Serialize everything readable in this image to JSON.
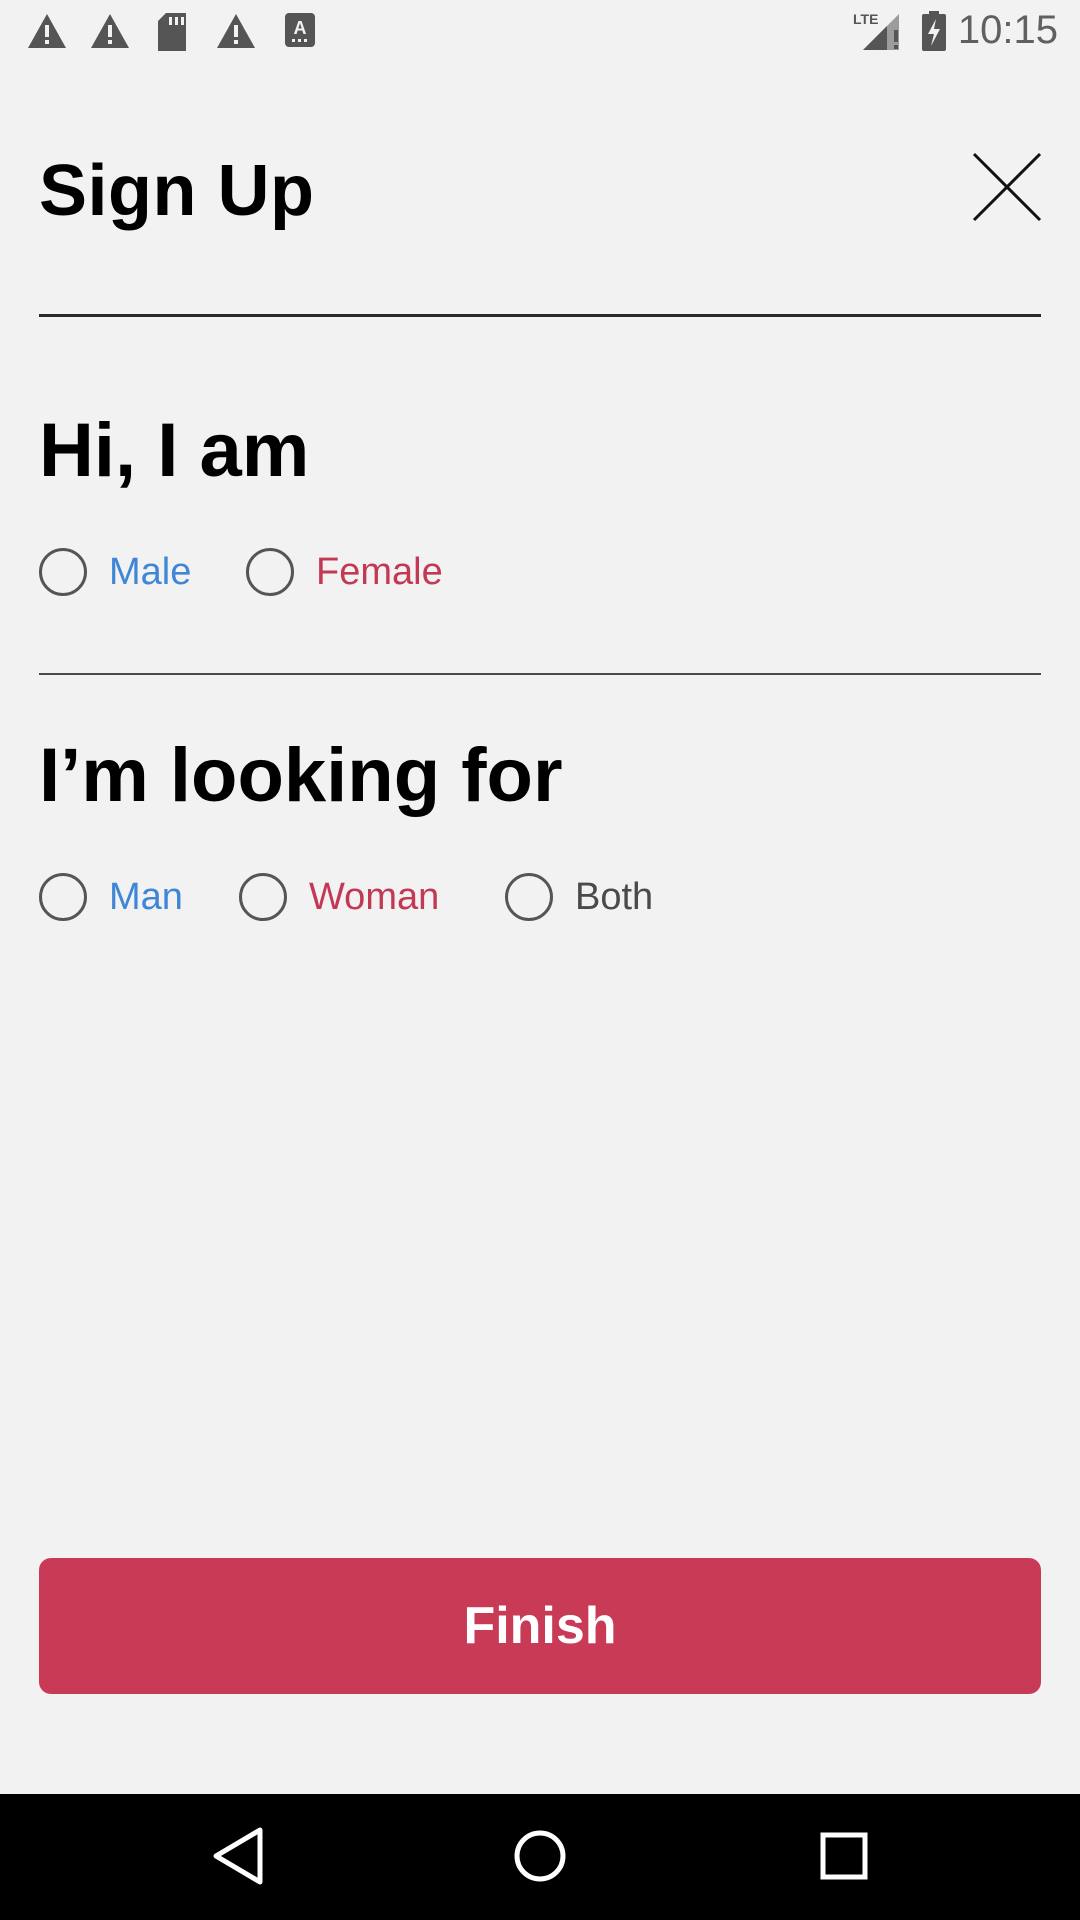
{
  "status_bar": {
    "icons_left": [
      "warning-icon",
      "warning-icon",
      "sd-card-icon",
      "warning-icon",
      "text-notification-icon"
    ],
    "network": "LTE",
    "time": "10:15"
  },
  "header": {
    "title": "Sign Up",
    "close_icon": "close-icon"
  },
  "gender_section": {
    "title": "Hi, I am",
    "options": [
      {
        "label": "Male",
        "color": "#3f87d6",
        "selected": false
      },
      {
        "label": "Female",
        "color": "#c33953",
        "selected": false
      }
    ]
  },
  "looking_for_section": {
    "title": "I’m looking for",
    "options": [
      {
        "label": "Man",
        "color": "#3f87d6",
        "selected": false
      },
      {
        "label": "Woman",
        "color": "#c33953",
        "selected": false
      },
      {
        "label": "Both",
        "color": "#4a4a4a",
        "selected": false
      }
    ]
  },
  "finish_button": {
    "label": "Finish",
    "color": "#c83a56"
  },
  "nav_bar": {
    "buttons": [
      "back-icon",
      "home-icon",
      "recents-icon"
    ]
  }
}
